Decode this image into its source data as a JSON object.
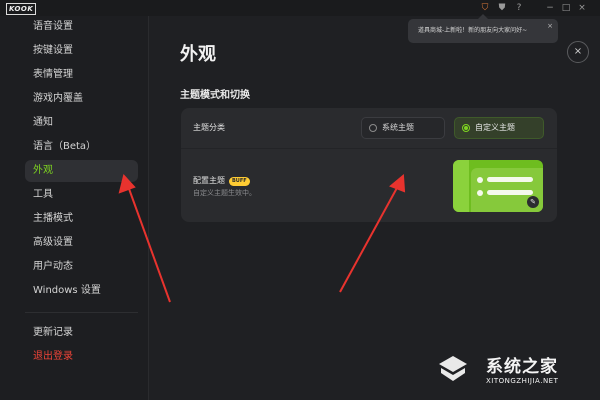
{
  "app": {
    "logo": "KOOK"
  },
  "titlebar": {
    "icons": [
      "store-icon",
      "shirt-icon",
      "help-icon",
      "minimize-icon",
      "maximize-icon",
      "close-icon"
    ]
  },
  "sidebar": {
    "items": [
      {
        "label": "语音设置"
      },
      {
        "label": "按键设置"
      },
      {
        "label": "表情管理"
      },
      {
        "label": "游戏内覆盖"
      },
      {
        "label": "通知"
      },
      {
        "label": "语言（Beta）"
      },
      {
        "label": "外观",
        "active": true
      },
      {
        "label": "工具"
      },
      {
        "label": "主播模式"
      },
      {
        "label": "高级设置"
      },
      {
        "label": "用户动态"
      },
      {
        "label": "Windows 设置"
      }
    ],
    "bottom": [
      {
        "label": "更新记录"
      },
      {
        "label": "退出登录"
      }
    ]
  },
  "main": {
    "title": "外观",
    "section_title": "主题模式和切换",
    "theme_category": {
      "label": "主题分类",
      "options": [
        {
          "label": "系统主题",
          "selected": false
        },
        {
          "label": "自定义主题",
          "selected": true
        }
      ]
    },
    "config_theme": {
      "label": "配置主题",
      "badge": "BUFF",
      "description": "自定义主题生效中。"
    }
  },
  "toast": {
    "text": "道具商城-上新啦！新的朋友向大家问好~",
    "close": "×"
  },
  "close_button": {
    "symbol": "×"
  },
  "watermark": {
    "text": "系统之家",
    "url": "XITONGZHIJIA.NET"
  },
  "colors": {
    "accent": "#7ed321",
    "logout": "#f04438",
    "badge": "#ffcc33",
    "annotation_arrow": "#e8332e"
  }
}
